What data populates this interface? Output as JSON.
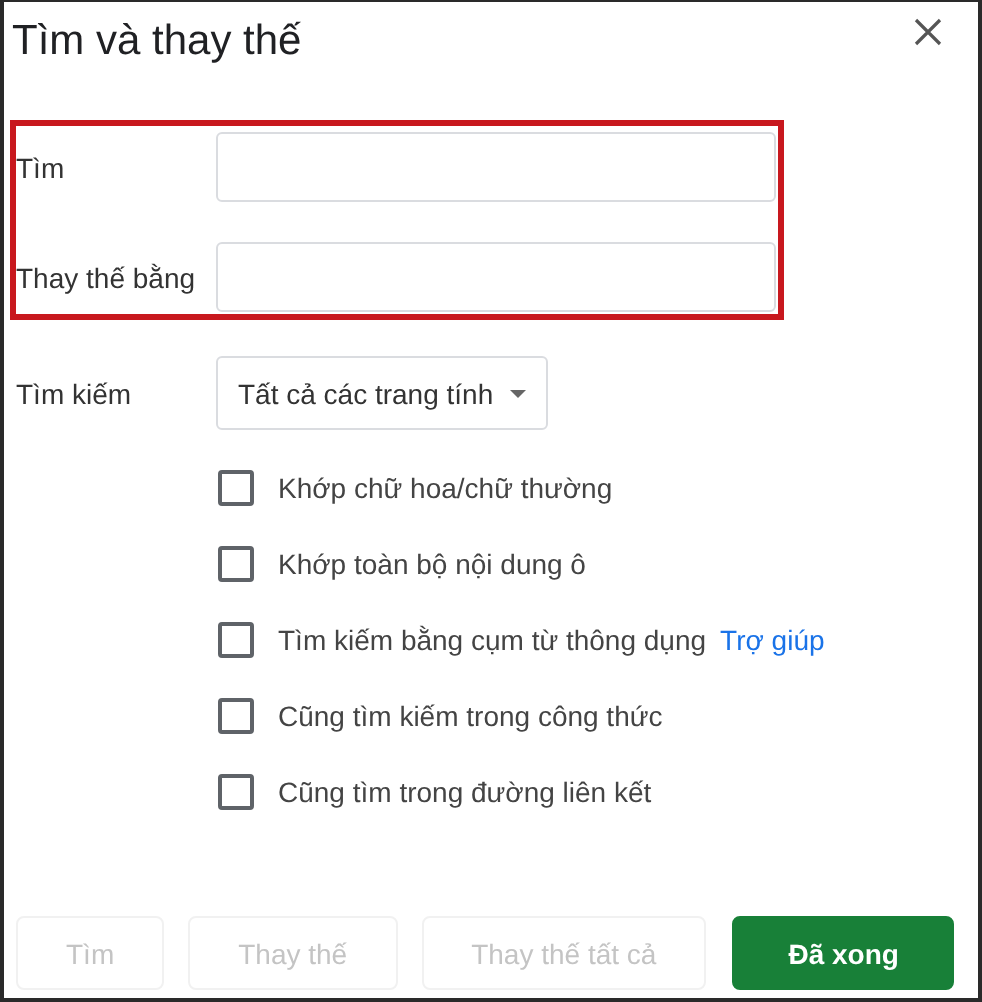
{
  "dialog": {
    "title": "Tìm và thay thế"
  },
  "fields": [
    {
      "label": "Tìm"
    },
    {
      "label": "Thay thế bằng"
    }
  ],
  "search_scope": {
    "label": "Tìm kiếm",
    "value": "Tất cả các trang tính"
  },
  "options": [
    {
      "label": "Khớp chữ hoa/chữ thường",
      "checked": false
    },
    {
      "label": "Khớp toàn bộ nội dung ô",
      "checked": false
    },
    {
      "label": "Tìm kiếm bằng cụm từ thông dụng",
      "checked": false,
      "link": "Trợ giúp"
    },
    {
      "label": "Cũng tìm kiếm trong công thức",
      "checked": false
    },
    {
      "label": "Cũng tìm trong đường liên kết",
      "checked": false
    }
  ],
  "buttons": [
    {
      "label": "Tìm",
      "disabled": true,
      "kind": "plain"
    },
    {
      "label": "Thay thế",
      "disabled": true,
      "kind": "plain"
    },
    {
      "label": "Thay thế tất cả",
      "disabled": true,
      "kind": "plain"
    },
    {
      "label": "Đã xong",
      "disabled": false,
      "kind": "primary"
    }
  ]
}
